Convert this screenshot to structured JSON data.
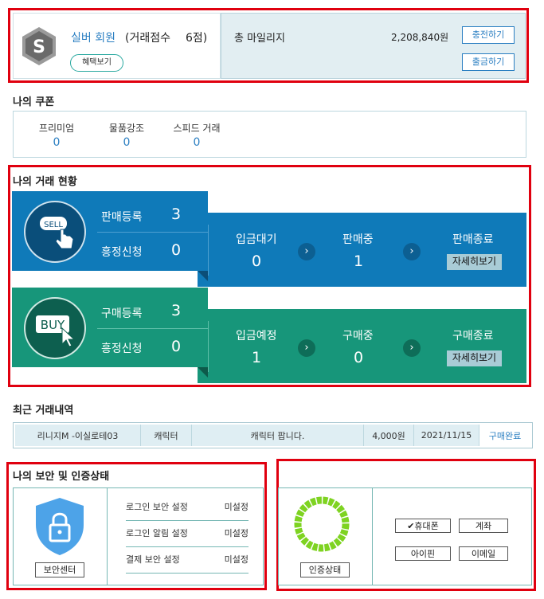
{
  "member": {
    "grade": "실버 회원",
    "score_label": "(거래점수",
    "score_value": "6점)",
    "benefit_button": "혜택보기",
    "mileage_label": "총 마일리지",
    "mileage_value": "2,208,840원",
    "charge_button": "충전하기",
    "withdraw_button": "출금하기",
    "badge_letter": "S"
  },
  "coupons": {
    "title": "나의 쿠폰",
    "items": [
      {
        "label": "프리미엄",
        "value": "0"
      },
      {
        "label": "물품강조",
        "value": "0"
      },
      {
        "label": "스피드 거래",
        "value": "0"
      }
    ]
  },
  "trade": {
    "title": "나의 거래 현황",
    "sell": {
      "icon_text": "SELL",
      "register_label": "판매등록",
      "register_value": "3",
      "correction_label": "흥정신청",
      "correction_value": "0",
      "steps": [
        {
          "label": "입금대기",
          "value": "0"
        },
        {
          "label": "판매중",
          "value": "1"
        }
      ],
      "end_label": "판매종료",
      "detail_button": "자세히보기",
      "color": "#0f7ab9"
    },
    "buy": {
      "icon_text": "BUY",
      "register_label": "구매등록",
      "register_value": "3",
      "correction_label": "흥정신청",
      "correction_value": "0",
      "steps": [
        {
          "label": "입금예정",
          "value": "1"
        },
        {
          "label": "구매중",
          "value": "0"
        }
      ],
      "end_label": "구매종료",
      "detail_button": "자세히보기",
      "color": "#17967a"
    }
  },
  "recent": {
    "title": "최근 거래내역",
    "row": [
      "리니지M -이실로테03",
      "캐릭터",
      "캐릭터 팝니다.",
      "4,000원",
      "2021/11/15",
      "구매완료"
    ]
  },
  "security": {
    "title": "나의 보안 및 인증상태",
    "center_button": "보안센터",
    "rows": [
      {
        "label": "로그인 보안 설정",
        "value": "미설정"
      },
      {
        "label": "로그인 알림 설정",
        "value": "미설정"
      },
      {
        "label": "결제 보안 설정",
        "value": "미설정"
      }
    ]
  },
  "certification": {
    "status_button": "인증상태",
    "items": [
      "✔휴대폰",
      "계좌",
      "아이핀",
      "이메일"
    ]
  }
}
